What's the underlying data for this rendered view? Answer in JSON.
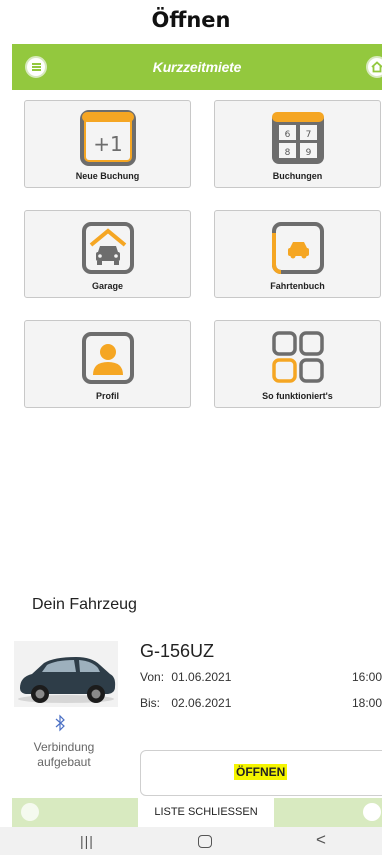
{
  "caption": "Öffnen",
  "header": {
    "title": "Kurzzeitmiete"
  },
  "tiles": [
    {
      "label": "Neue Buchung",
      "icon": "plus-one-icon",
      "icon_text": "+1"
    },
    {
      "label": "Buchungen",
      "icon": "calendar-grid-icon",
      "digits": [
        "6",
        "7",
        "8",
        "9"
      ]
    },
    {
      "label": "Garage",
      "icon": "garage-icon"
    },
    {
      "label": "Fahrtenbuch",
      "icon": "car-logbook-icon"
    },
    {
      "label": "Profil",
      "icon": "profile-icon"
    },
    {
      "label": "So funktioniert's",
      "icon": "apps-grid-icon"
    }
  ],
  "vehicle": {
    "section_title": "Dein Fahrzeug",
    "plate": "G-156UZ",
    "from_label": "Von:",
    "from_date": "01.06.2021",
    "from_time": "16:00",
    "to_label": "Bis:",
    "to_date": "02.06.2021",
    "to_time": "18:00",
    "connection_line1": "Verbindung",
    "connection_line2": "aufgebaut",
    "open_label": "ÖFFNEN"
  },
  "bottom": {
    "close_list_label": "LISTE SCHLIESSEN"
  },
  "nav": {
    "recents": "|||",
    "back": "<"
  },
  "colors": {
    "accent_green": "#93c83e",
    "accent_orange": "#f5a623",
    "icon_grey": "#6d6d6d",
    "highlight_yellow": "#f5f500"
  }
}
